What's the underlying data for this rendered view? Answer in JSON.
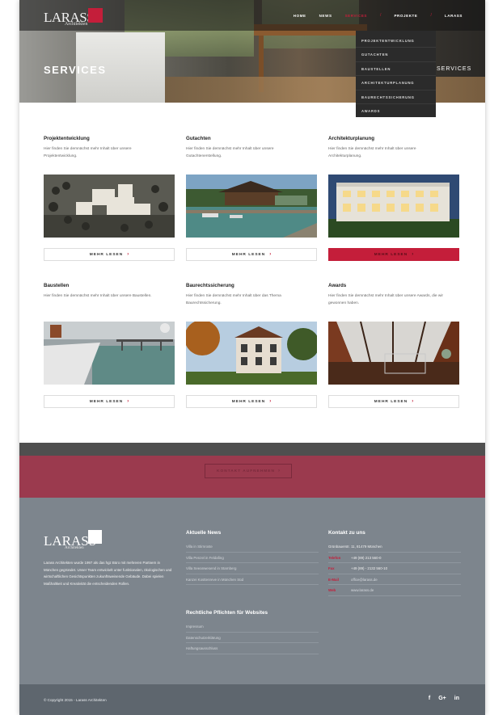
{
  "brand": {
    "logo_text": "LARASS",
    "logo_sub": "Architekten"
  },
  "nav": {
    "items": [
      {
        "label": "HOME"
      },
      {
        "label": "NEWS"
      },
      {
        "label": "SERVICES"
      },
      {
        "label": "PROJEKTE"
      },
      {
        "label": "LARASS"
      }
    ],
    "active": "SERVICES",
    "accent_color": "#c41e3a"
  },
  "hero": {
    "title": "SERVICES",
    "right_label": "SERVICES"
  },
  "dropdown": {
    "items": [
      "PROJEKTENTWICKLUNG",
      "GUTACHTEN",
      "BAUSTELLEN",
      "ARCHITEKTURPLANUNG",
      "BAURECHTSSICHERUNG",
      "AWARDS"
    ]
  },
  "services": [
    {
      "title": "Projektentwicklung",
      "text": "Hier finden Sie demnächst mehr Inhalt über unsere Projektentwicklung.",
      "button": "MEHR LESEN",
      "primary": false
    },
    {
      "title": "Gutachten",
      "text": "Hier finden Sie demnächst mehr Inhalt über unsere Gutachtenerstellung.",
      "button": "MEHR LESEN",
      "primary": false
    },
    {
      "title": "Architekturplanung",
      "text": "Hier finden Sie demnächst mehr Inhalt über unsere Architekturplanung.",
      "button": "MEHR LESEN",
      "primary": true
    },
    {
      "title": "Baustellen",
      "text": "Hier finden Sie demnächst mehr Inhalt über unsere Baustellen.",
      "button": "MEHR LESEN",
      "primary": false
    },
    {
      "title": "Baurechtssicherung",
      "text": "Hier finden Sie demnächst mehr Inhalt über das Thema Baurechtssicherung.",
      "button": "MEHR LESEN",
      "primary": false
    },
    {
      "title": "Awards",
      "text": "Hier finden Sie demnächst mehr Inhalt über unsere Awards, die wir gewonnen haben.",
      "button": "MEHR LESEN",
      "primary": false
    }
  ],
  "band": {
    "button": "KONTAKT AUFNEHMEN"
  },
  "footer": {
    "about": "Larass Architekten wurde 1997 als das hgz Büro mit mehreren Partnern in München gegründet. Unser Team ent­wickelt unter funktionalen, ökologischen und wirtschaftlichen Gesichtspunkten zukunftsweisende Gebäude. Dabei spielen Maßhaltkeit und Kreativität die entscheidenden Rollen.",
    "news_title": "Aktuelle News",
    "news": [
      "Villa in Stirnroste",
      "Villa Penzel in Feldafing",
      "Villa Seeanwesend in Starnberg",
      "Kanzei Kosttenreve in München Süd"
    ],
    "legal_title": "Rechtliche Pflichten für Websites",
    "legal": [
      "Impressum",
      "Datenschutzerklärung",
      "Haftungsausschluss"
    ],
    "contact_title": "Kontakt zu uns",
    "address": "Grünbauerstr. 11, 81479 München",
    "contact": [
      {
        "key": "Telefon",
        "value": "+49 (89) 213 560-0"
      },
      {
        "key": "Fax",
        "value": "+49 (89) - 2132 560-10"
      },
      {
        "key": "E-Mail",
        "value": "office@larass.de"
      },
      {
        "key": "Web",
        "value": "www.larass.de"
      }
    ],
    "copyright": "© Copyright 2015 - Larass Architekten",
    "social": [
      "f",
      "G+",
      "in"
    ]
  }
}
